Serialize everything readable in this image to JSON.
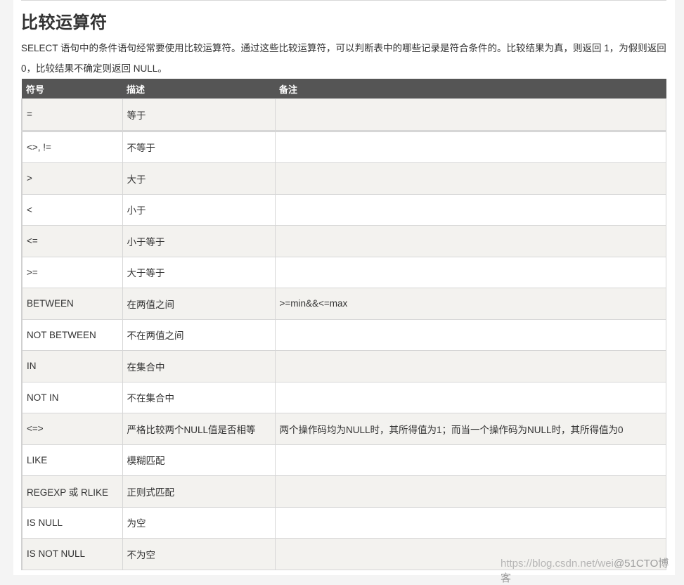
{
  "section": {
    "title": "比较运算符",
    "intro": "SELECT 语句中的条件语句经常要使用比较运算符。通过这些比较运算符，可以判断表中的哪些记录是符合条件的。比较结果为真，则返回 1，为假则返回 0，比较结果不确定则返回 NULL。"
  },
  "table": {
    "headers": [
      "符号",
      "描述",
      "备注"
    ],
    "rows": [
      {
        "symbol": "=",
        "desc": "等于",
        "note": ""
      },
      {
        "symbol": "<>, !=",
        "desc": "不等于",
        "note": ""
      },
      {
        "symbol": ">",
        "desc": "大于",
        "note": ""
      },
      {
        "symbol": "<",
        "desc": "小于",
        "note": ""
      },
      {
        "symbol": "<=",
        "desc": "小于等于",
        "note": ""
      },
      {
        "symbol": ">=",
        "desc": "大于等于",
        "note": ""
      },
      {
        "symbol": "BETWEEN",
        "desc": "在两值之间",
        "note": ">=min&&<=max"
      },
      {
        "symbol": "NOT BETWEEN",
        "desc": "不在两值之间",
        "note": ""
      },
      {
        "symbol": "IN",
        "desc": "在集合中",
        "note": ""
      },
      {
        "symbol": "NOT IN",
        "desc": "不在集合中",
        "note": ""
      },
      {
        "symbol": "<=>",
        "desc": "严格比较两个NULL值是否相等",
        "note": "两个操作码均为NULL时，其所得值为1；而当一个操作码为NULL时，其所得值为0"
      },
      {
        "symbol": "LIKE",
        "desc": "模糊匹配",
        "note": ""
      },
      {
        "symbol": "REGEXP 或 RLIKE",
        "desc": "正则式匹配",
        "note": ""
      },
      {
        "symbol": "IS NULL",
        "desc": "为空",
        "note": ""
      },
      {
        "symbol": "IS NOT NULL",
        "desc": "不为空",
        "note": ""
      }
    ]
  },
  "watermark": {
    "url": "https://blog.csdn.net/wei",
    "brand": "@51CTO博客"
  }
}
